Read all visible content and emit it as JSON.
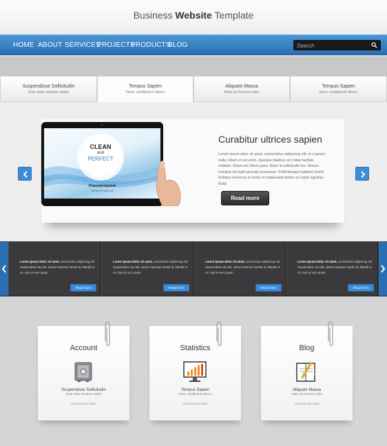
{
  "header": {
    "title_pre": "Business ",
    "title_bold": "Website",
    "title_post": " Template"
  },
  "nav": {
    "items": [
      "HOME",
      "ABOUT",
      "SERVICES",
      "PROJECTS",
      "PRODUCTS",
      "BLOG"
    ],
    "search_placeholder": "Search"
  },
  "tabs": [
    {
      "title": "Suspendisse Sollicitudin",
      "sub": "Duis vitae semper turpis"
    },
    {
      "title": "Tempus Sapien",
      "sub": "Nunc vestibulum libero"
    },
    {
      "title": "Aliquam Massa",
      "sub": "Nam at rhoncus odio"
    },
    {
      "title": "Tempus Sapien",
      "sub": "Nunc vestibulum libero"
    }
  ],
  "slider": {
    "tablet": {
      "line1": "CLEAN",
      "line2": "and",
      "line3": "PERFECT",
      "caption1": "Praesent laoreet",
      "caption2": "elit lorem dolor sit"
    },
    "title": "Curabitur ultrices sapien",
    "text": "Lorem ipsum dolor sit amet, consectetur adipiscing elit. In a ipsum nulla. Etiam et est enim. Quisque dapibus orci vitae facilisis sodales. Etiam nec libero justo. Nunc id sollicitudin leo. Mauris volutpat nisl eget gravida accumsan. Pellentesque habitant morbi tristique senectus et netus et malesuada fames ac turpis egestas. Nulla",
    "button": "Read more"
  },
  "strip": {
    "panels": [
      {
        "bold": "Lorem ipsum dolor sit amet,",
        "text": " consectetur adipiscing elit. Suspendisse dui elit, varius maximus iaculis id, blandit ut mi. Sed ut sem quam.",
        "button": "Read more"
      },
      {
        "bold": "Lorem ipsum dolor sit amet,",
        "text": " consectetur adipiscing elit. Suspendisse dui elit, varius maximus iaculis id, blandit ut mi. Sed ut sem quam.",
        "button": "Read more"
      },
      {
        "bold": "Lorem ipsum dolor sit amet,",
        "text": " consectetur adipiscing elit. Suspendisse dui elit, varius maximus iaculis id, blandit ut mi. Sed ut sem quam.",
        "button": "Read more"
      },
      {
        "bold": "Lorem ipsum dolor sit amet,",
        "text": " consectetur adipiscing elit. Suspendisse dui elit, varius maximus iaculis id, blandit ut mi. Sed ut sem quam.",
        "button": "Read more"
      }
    ]
  },
  "cards": [
    {
      "title": "Account",
      "icon": "safe-icon",
      "sub1": "Suspendisse Sollicitudin",
      "sub2": "Duis vitae semper turpis",
      "sub3": "Vivamus dui diam"
    },
    {
      "title": "Statistics",
      "icon": "monitor-chart-icon",
      "sub1": "Tempus Sapien",
      "sub2": "Nunc vestibulum libero",
      "sub3": "Vivamus dui diam"
    },
    {
      "title": "Blog",
      "icon": "notebook-pen-icon",
      "sub1": "Aliquam Massa",
      "sub2": "Nam at rhoncus odio",
      "sub3": "Vivamus dui diam"
    }
  ],
  "colors": {
    "accent": "#3d8ed6",
    "nav": "#2a6fb3",
    "strip": "#3a3a3c"
  }
}
